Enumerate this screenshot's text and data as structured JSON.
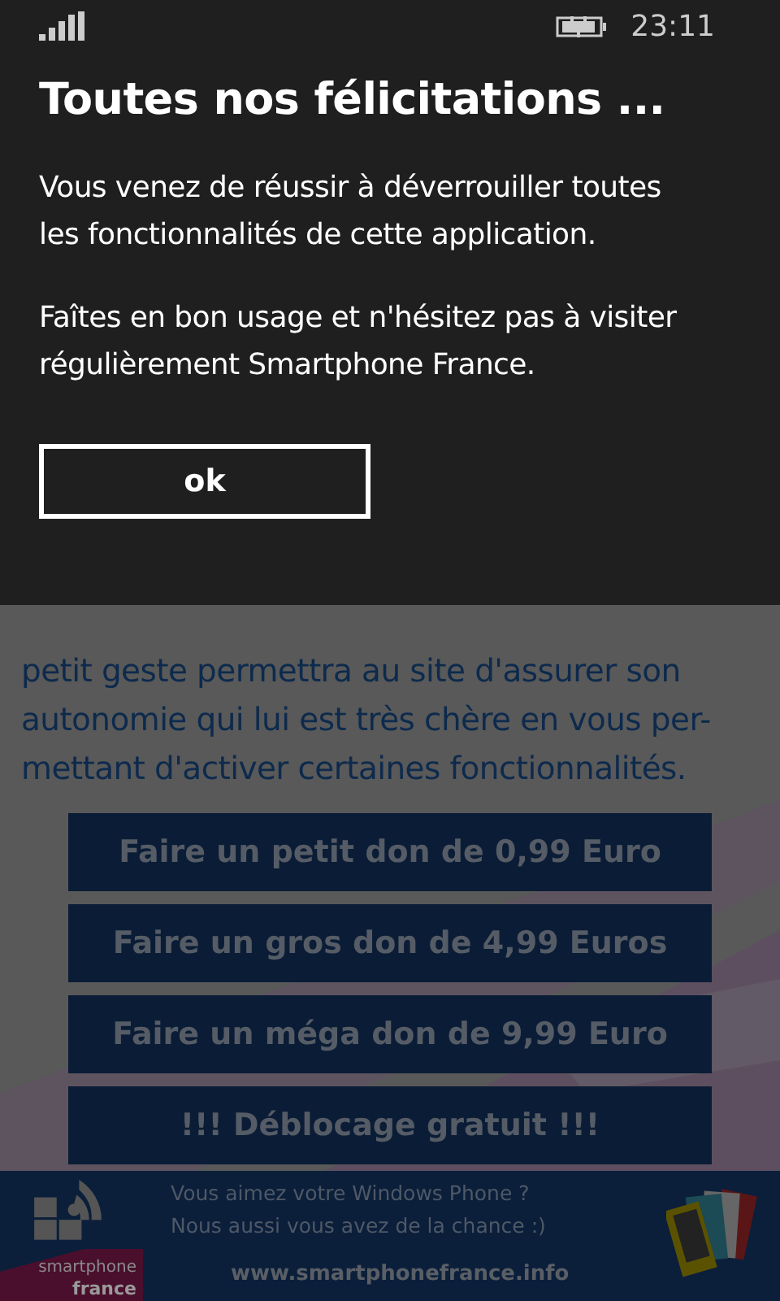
{
  "status_bar": {
    "time": "23:11"
  },
  "dialog": {
    "title": "Toutes nos félicitations ...",
    "paragraphs": [
      "Vous venez de réussir à déverrouiller toutes les fonctionnalités de cette application.",
      "Faîtes en bon usage et n'hésitez pas à visiter régulièrement Smartphone France."
    ],
    "button": "ok"
  },
  "page": {
    "paragraph_lines": [
      "petit geste permettra au site d'assurer son",
      "autonomie qui lui est très chère en vous per-",
      "mettant d'activer certaines fonctionnalités."
    ],
    "buttons": [
      "Faire un petit don de 0,99 Euro",
      "Faire un gros don de 4,99 Euros",
      "Faire un méga don de 9,99 Euro",
      "!!! Déblocage gratuit !!!"
    ]
  },
  "banner": {
    "logo_lines": [
      "smartphone",
      "france"
    ],
    "lines": [
      "Vous aimez votre Windows Phone ?",
      "Nous aussi vous avez de la chance :)"
    ],
    "url": "www.smartphonefrance.info"
  }
}
